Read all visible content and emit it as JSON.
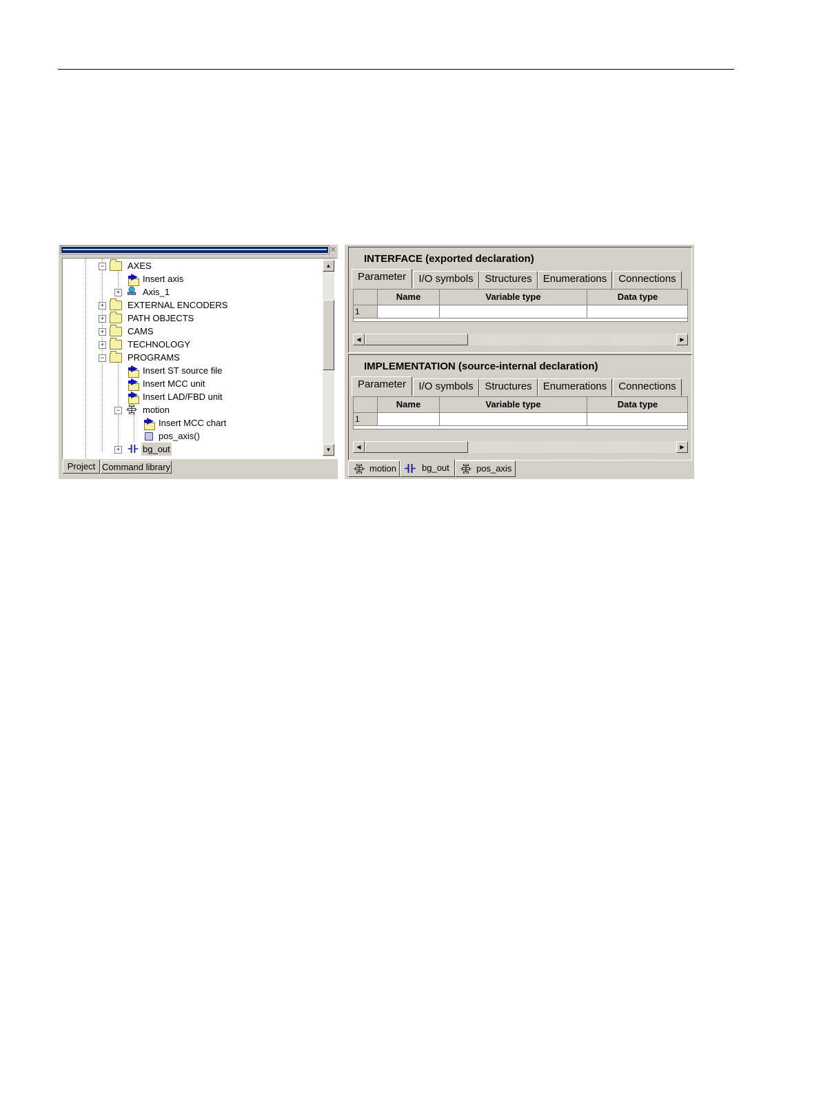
{
  "project_tree": {
    "nodes": [
      {
        "label": "AXES",
        "icon": "folder-icon",
        "expander": "minus"
      },
      {
        "label": "Insert axis",
        "icon": "insert-icon",
        "expander": ""
      },
      {
        "label": "Axis_1",
        "icon": "axis-icon",
        "expander": "plus"
      },
      {
        "label": "EXTERNAL ENCODERS",
        "icon": "folder-icon",
        "expander": "plus"
      },
      {
        "label": "PATH OBJECTS",
        "icon": "folder-icon",
        "expander": "plus"
      },
      {
        "label": "CAMS",
        "icon": "folder-icon",
        "expander": "plus"
      },
      {
        "label": "TECHNOLOGY",
        "icon": "folder-icon",
        "expander": "plus"
      },
      {
        "label": "PROGRAMS",
        "icon": "folder-icon",
        "expander": "minus"
      },
      {
        "label": "Insert ST source file",
        "icon": "insert-icon",
        "expander": ""
      },
      {
        "label": "Insert MCC unit",
        "icon": "insert-icon",
        "expander": ""
      },
      {
        "label": "Insert LAD/FBD unit",
        "icon": "insert-icon",
        "expander": ""
      },
      {
        "label": "motion",
        "icon": "mcc-unit-icon",
        "expander": "minus"
      },
      {
        "label": "Insert MCC chart",
        "icon": "insert-icon",
        "expander": ""
      },
      {
        "label": "pos_axis()",
        "icon": "chart-icon",
        "expander": ""
      },
      {
        "label": "bg_out",
        "icon": "lad-unit-icon",
        "expander": "plus"
      }
    ],
    "tabs": [
      "Project",
      "Command library"
    ]
  },
  "interface_section": {
    "title": "INTERFACE (exported declaration)",
    "tabs": [
      "Parameter",
      "I/O symbols",
      "Structures",
      "Enumerations",
      "Connections"
    ],
    "columns": [
      "Name",
      "Variable type",
      "Data type"
    ],
    "rows": [
      {
        "index": "1"
      }
    ]
  },
  "implementation_section": {
    "title": "IMPLEMENTATION (source-internal declaration)",
    "tabs": [
      "Parameter",
      "I/O symbols",
      "Structures",
      "Enumerations",
      "Connections"
    ],
    "columns": [
      "Name",
      "Variable type",
      "Data type"
    ],
    "rows": [
      {
        "index": "1"
      }
    ]
  },
  "editor_tabs": [
    {
      "label": "motion",
      "icon": "mcc-unit-icon"
    },
    {
      "label": "bg_out",
      "icon": "lad-unit-icon"
    },
    {
      "label": "pos_axis",
      "icon": "mcc-unit-icon"
    }
  ],
  "icons": {
    "close": "close-icon",
    "scroll_up": "arrow-up-icon",
    "scroll_down": "arrow-down-icon",
    "scroll_left": "arrow-left-icon",
    "scroll_right": "arrow-right-icon"
  }
}
